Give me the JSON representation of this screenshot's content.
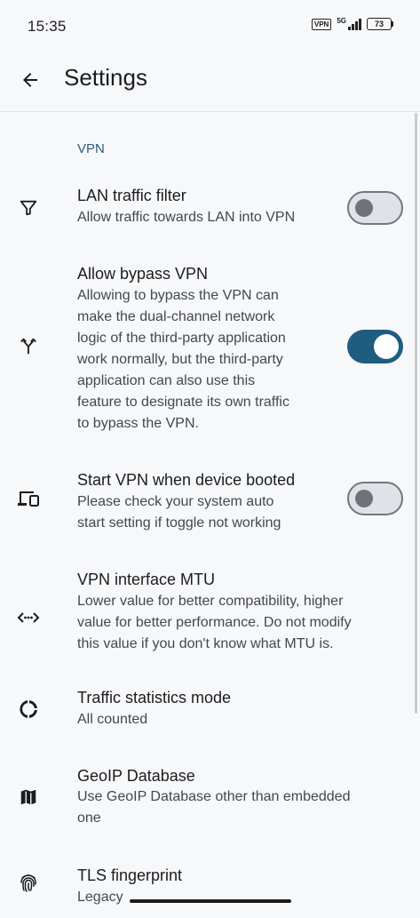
{
  "status_bar": {
    "time": "15:35",
    "vpn_badge": "VPN",
    "network": "5G",
    "battery": "73"
  },
  "app_bar": {
    "back_icon": "arrow-left-icon",
    "title": "Settings"
  },
  "section": {
    "header": "VPN"
  },
  "items": [
    {
      "icon": "filter-icon",
      "title": "LAN traffic filter",
      "summary_lines": [
        "Allow traffic towards LAN into VPN"
      ],
      "toggle": "off"
    },
    {
      "icon": "fork-arrows-icon",
      "title": "Allow bypass VPN",
      "summary_lines": [
        "Allowing to bypass the VPN can",
        "make the dual-channel network",
        "logic of the third-party application",
        "work normally, but the third-party",
        "application can also use this",
        "feature to designate its own traffic",
        "to bypass the VPN."
      ],
      "toggle": "on"
    },
    {
      "icon": "devices-icon",
      "title": "Start VPN when device booted",
      "summary_lines": [
        "Please check your system auto",
        "start setting if toggle not working"
      ],
      "toggle": "off"
    },
    {
      "icon": "settings-ethernet-icon",
      "title": "VPN interface MTU",
      "summary_lines": [
        "Lower value for better compatibility, higher",
        "value for better performance. Do not modify",
        "this value if you don't know what MTU is."
      ]
    },
    {
      "icon": "donut-chart-icon",
      "title": "Traffic statistics mode",
      "summary_lines": [
        "All counted"
      ]
    },
    {
      "icon": "map-icon",
      "title": "GeoIP Database",
      "summary_lines": [
        "Use GeoIP Database other than embedded",
        "one"
      ]
    },
    {
      "icon": "fingerprint-icon",
      "title": "TLS fingerprint",
      "summary_lines": [
        "Legacy"
      ]
    }
  ]
}
